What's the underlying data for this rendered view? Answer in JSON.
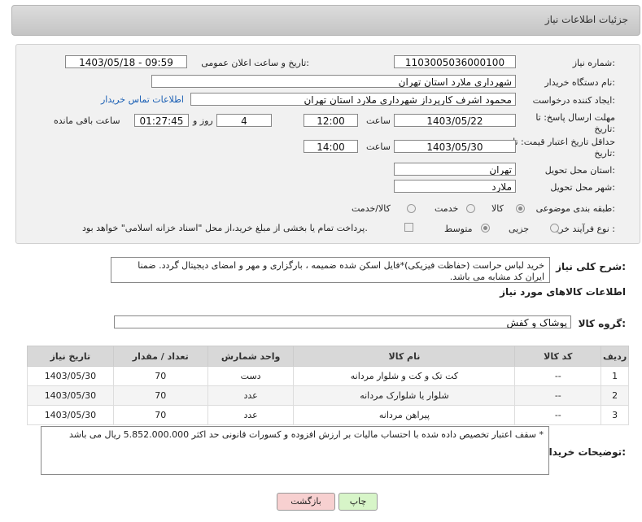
{
  "header": {
    "title": "جزئیات اطلاعات نیاز"
  },
  "form": {
    "need_number_label": "شماره نیاز:",
    "need_number": "1103005036000100",
    "announce_label": "تاریخ و ساعت اعلان عمومی:",
    "announce_value": "1403/05/18 - 09:59",
    "buyer_org_label": "نام دستگاه خریدار:",
    "buyer_org": "شهرداری ملارد استان تهران",
    "creator_label": "ایجاد کننده درخواست:",
    "creator": "محمود اشرف کارپرداز  شهرداری ملارد استان تهران",
    "buyer_contact_link": "اطلاعات تماس خریدار",
    "reply_deadline_label_1": "مهلت ارسال پاسخ: تا",
    "reply_deadline_label_2": "تاریخ:",
    "reply_date": "1403/05/22",
    "time_label": "ساعت",
    "reply_time": "12:00",
    "days_value": "4",
    "days_label": "روز و",
    "remaining_time": "01:27:45",
    "remaining_label": "ساعت باقی مانده",
    "price_validity_label_1": "حداقل تاریخ اعتبار قیمت: تا",
    "price_validity_label_2": "تاریخ:",
    "price_date": "1403/05/30",
    "price_time": "14:00",
    "province_label": "استان محل تحویل:",
    "province": "تهران",
    "city_label": "شهر محل تحویل:",
    "city": "ملارد",
    "category_label": "طبقه بندی موضوعی:",
    "category_options": [
      "کالا",
      "خدمت",
      "کالا/خدمت"
    ],
    "process_label": "نوع فرآیند خرید :",
    "process_options": [
      "جزیی",
      "متوسط"
    ],
    "payment_note": "پرداخت تمام یا بخشی از مبلغ خرید،از محل \"اسناد خزانه اسلامی\" خواهد بود."
  },
  "description": {
    "label": "شرح کلی نیاز:",
    "text": "خرید لباس حراست (حفاظت فیزیکی)*فایل اسکن شده ضمیمه ، بارگزاری و مهر و امضای دیجیتال گردد. ضمنا ایران کد مشابه می باشد."
  },
  "goods_section": {
    "title": "اطلاعات کالاهای مورد نیاز",
    "group_label": "گروه کالا:",
    "group_value": "پوشاک و کفش"
  },
  "table": {
    "headers": [
      "ردیف",
      "کد کالا",
      "نام کالا",
      "واحد شمارش",
      "تعداد / مقدار",
      "تاریخ نیاز"
    ],
    "rows": [
      [
        "1",
        "--",
        "کت تک و کت و شلوار مردانه",
        "دست",
        "70",
        "1403/05/30"
      ],
      [
        "2",
        "--",
        "شلوار یا شلوارک مردانه",
        "عدد",
        "70",
        "1403/05/30"
      ],
      [
        "3",
        "--",
        "پیراهن مردانه",
        "عدد",
        "70",
        "1403/05/30"
      ]
    ]
  },
  "notes": {
    "label": "توضیحات خریدار:",
    "text": "* سقف اعتبار تخصیص داده شده با احتساب مالیات بر ارزش افزوده و کسورات قانونی حد اکثر 5.852.000.000 ریال می باشد"
  },
  "buttons": {
    "print": "چاپ",
    "back": "بازگشت"
  },
  "colors": {
    "link": "#1a5fb4",
    "print_bg": "#d7f5c8",
    "back_bg": "#f7d0d0"
  }
}
